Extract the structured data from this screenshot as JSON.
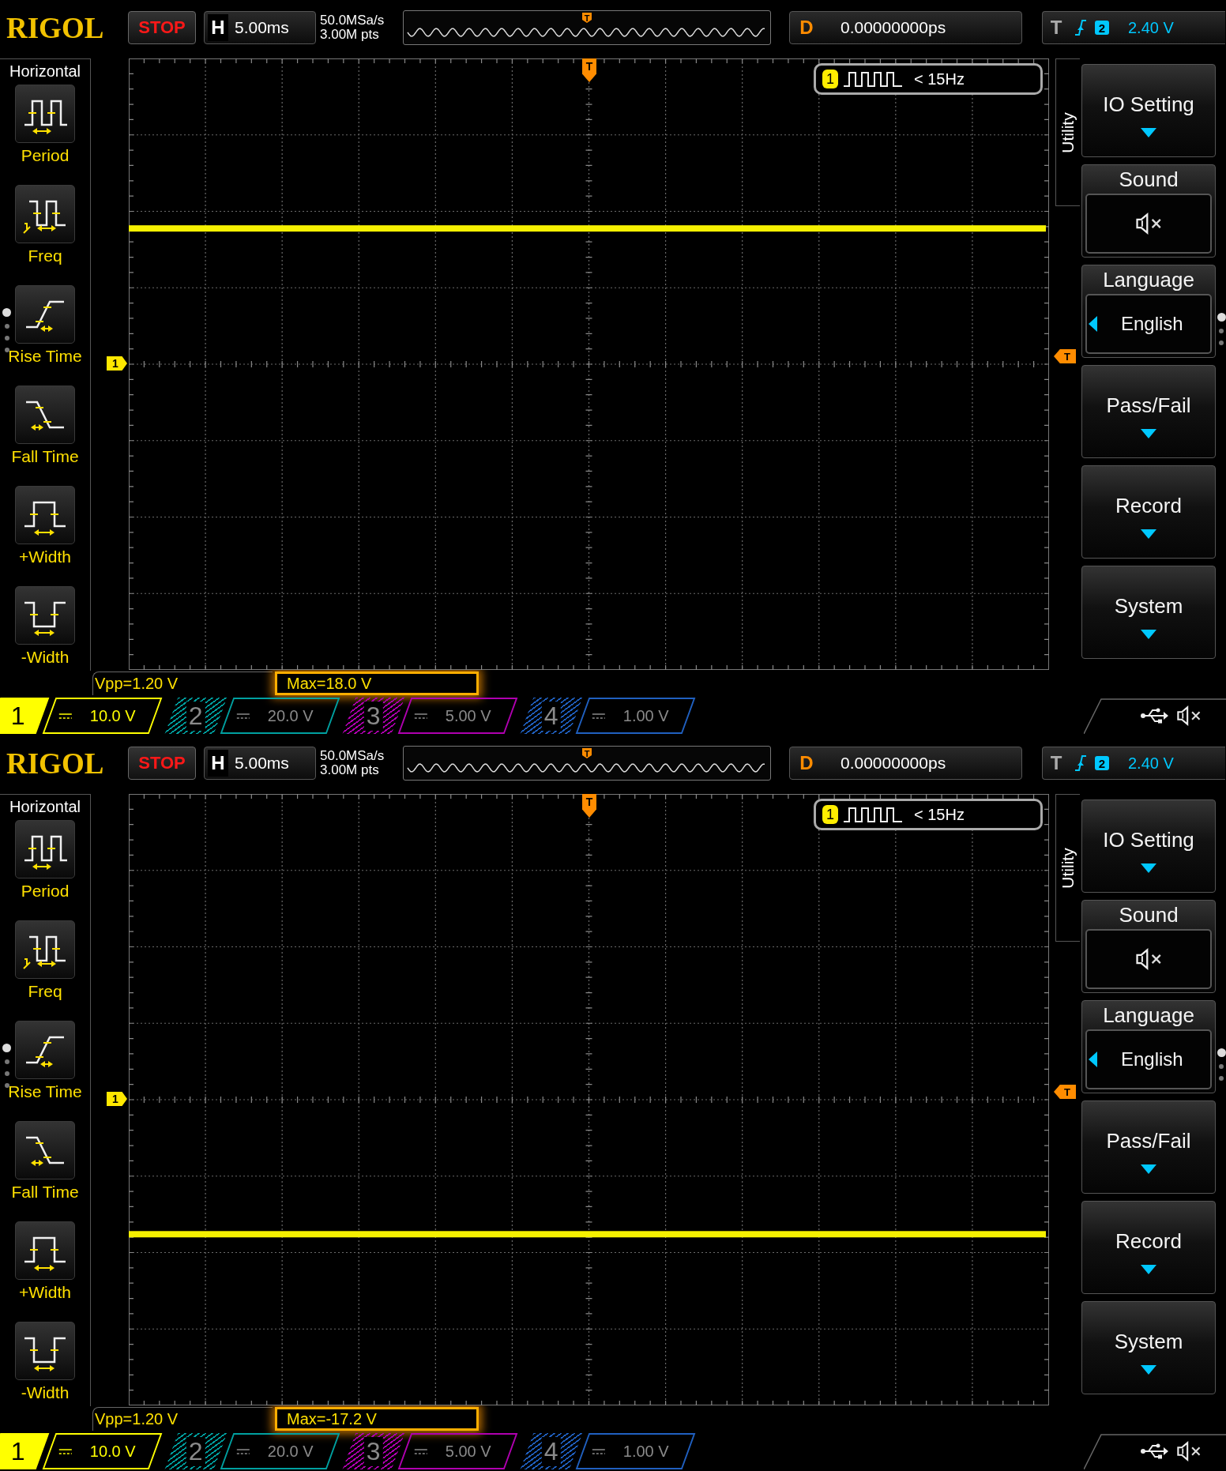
{
  "screens": [
    {
      "logo": "RIGOL",
      "run_state": "STOP",
      "timebase": {
        "label": "H",
        "value": "5.00ms"
      },
      "sample_rate": "50.0MSa/s",
      "memory_depth": "3.00M pts",
      "overview_trigger_marker": "T",
      "delay": {
        "label": "D",
        "value": "0.00000000ps"
      },
      "trigger": {
        "label": "T",
        "source": "2",
        "level": "2.40 V"
      },
      "left_menu": {
        "title": "Horizontal",
        "pages": [
          {
            "selected": true
          },
          {
            "selected": false
          },
          {
            "selected": false
          },
          {
            "selected": false
          }
        ],
        "items": [
          {
            "label": "Period",
            "kind": "period"
          },
          {
            "label": "Freq",
            "kind": "freq"
          },
          {
            "label": "Rise Time",
            "kind": "rise"
          },
          {
            "label": "Fall Time",
            "kind": "fall"
          },
          {
            "label": "+Width",
            "kind": "pwidth"
          },
          {
            "label": "-Width",
            "kind": "nwidth"
          }
        ]
      },
      "plot": {
        "trigger_position_marker": "T",
        "channel_marker": "1",
        "trigger_level_marker": "T",
        "frequency_counter": {
          "channel": "1",
          "reading": "< 15Hz"
        },
        "trace": {
          "above_center": true
        }
      },
      "right_menu": {
        "title": "Utility",
        "pages": [
          {
            "selected": true
          },
          {
            "selected": false
          },
          {
            "selected": false
          }
        ],
        "items": [
          {
            "kind": "submenu",
            "label": "IO Setting"
          },
          {
            "kind": "icon_value",
            "label": "Sound",
            "muted": true
          },
          {
            "kind": "select",
            "label": "Language",
            "value": "English"
          },
          {
            "kind": "submenu",
            "label": "Pass/Fail"
          },
          {
            "kind": "submenu",
            "label": "Record"
          },
          {
            "kind": "submenu",
            "label": "System"
          }
        ]
      },
      "measurements": [
        {
          "text": "Vpp=1.20 V",
          "highlighted": false
        },
        {
          "text": "Max=18.0 V",
          "highlighted": true
        }
      ],
      "channels": [
        {
          "number": "1",
          "scale": "10.0 V",
          "color": "#ffff00",
          "selected": true
        },
        {
          "number": "2",
          "scale": "20.0 V",
          "color": "#00a0a0",
          "selected": false
        },
        {
          "number": "3",
          "scale": "5.00 V",
          "color": "#b000b0",
          "selected": false
        },
        {
          "number": "4",
          "scale": "1.00 V",
          "color": "#2060c0",
          "selected": false
        }
      ],
      "status": {
        "muted": true
      }
    },
    {
      "logo": "RIGOL",
      "run_state": "STOP",
      "timebase": {
        "label": "H",
        "value": "5.00ms"
      },
      "sample_rate": "50.0MSa/s",
      "memory_depth": "3.00M pts",
      "overview_trigger_marker": "T",
      "delay": {
        "label": "D",
        "value": "0.00000000ps"
      },
      "trigger": {
        "label": "T",
        "source": "2",
        "level": "2.40 V"
      },
      "left_menu": {
        "title": "Horizontal",
        "pages": [
          {
            "selected": true
          },
          {
            "selected": false
          },
          {
            "selected": false
          },
          {
            "selected": false
          }
        ],
        "items": [
          {
            "label": "Period",
            "kind": "period"
          },
          {
            "label": "Freq",
            "kind": "freq"
          },
          {
            "label": "Rise Time",
            "kind": "rise"
          },
          {
            "label": "Fall Time",
            "kind": "fall"
          },
          {
            "label": "+Width",
            "kind": "pwidth"
          },
          {
            "label": "-Width",
            "kind": "nwidth"
          }
        ]
      },
      "plot": {
        "trigger_position_marker": "T",
        "channel_marker": "1",
        "trigger_level_marker": "T",
        "frequency_counter": {
          "channel": "1",
          "reading": "< 15Hz"
        },
        "trace": {
          "above_center": false
        }
      },
      "right_menu": {
        "title": "Utility",
        "pages": [
          {
            "selected": true
          },
          {
            "selected": false
          },
          {
            "selected": false
          }
        ],
        "items": [
          {
            "kind": "submenu",
            "label": "IO Setting"
          },
          {
            "kind": "icon_value",
            "label": "Sound",
            "muted": true
          },
          {
            "kind": "select",
            "label": "Language",
            "value": "English"
          },
          {
            "kind": "submenu",
            "label": "Pass/Fail"
          },
          {
            "kind": "submenu",
            "label": "Record"
          },
          {
            "kind": "submenu",
            "label": "System"
          }
        ]
      },
      "measurements": [
        {
          "text": "Vpp=1.20 V",
          "highlighted": false
        },
        {
          "text": "Max=-17.2 V",
          "highlighted": true
        }
      ],
      "channels": [
        {
          "number": "1",
          "scale": "10.0 V",
          "color": "#ffff00",
          "selected": true
        },
        {
          "number": "2",
          "scale": "20.0 V",
          "color": "#00a0a0",
          "selected": false
        },
        {
          "number": "3",
          "scale": "5.00 V",
          "color": "#b000b0",
          "selected": false
        },
        {
          "number": "4",
          "scale": "1.00 V",
          "color": "#2060c0",
          "selected": false
        }
      ],
      "status": {
        "muted": true
      }
    }
  ]
}
